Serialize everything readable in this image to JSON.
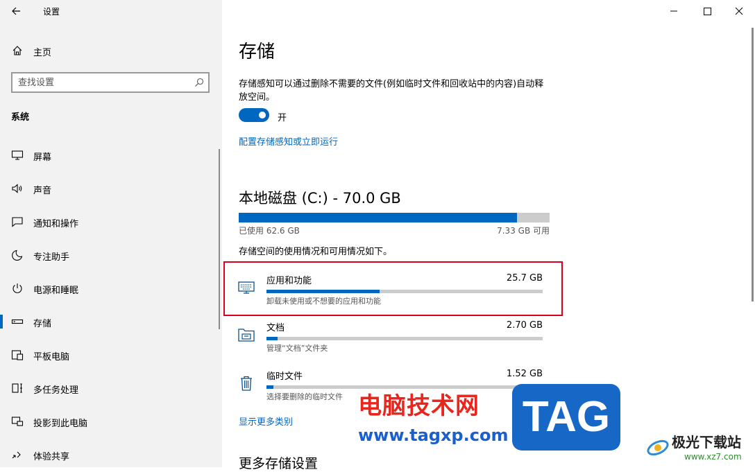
{
  "window": {
    "title": "设置",
    "back_icon": "arrow-left-icon",
    "controls": [
      "minimize-icon",
      "maximize-icon",
      "close-icon"
    ]
  },
  "sidebar": {
    "home_label": "主页",
    "search_placeholder": "查找设置",
    "section_label": "系统",
    "items": [
      {
        "label": "屏幕",
        "icon": "monitor-icon"
      },
      {
        "label": "声音",
        "icon": "speaker-icon"
      },
      {
        "label": "通知和操作",
        "icon": "notification-icon"
      },
      {
        "label": "专注助手",
        "icon": "moon-icon"
      },
      {
        "label": "电源和睡眠",
        "icon": "power-icon"
      },
      {
        "label": "存储",
        "icon": "storage-icon",
        "active": true
      },
      {
        "label": "平板电脑",
        "icon": "tablet-icon"
      },
      {
        "label": "多任务处理",
        "icon": "multitask-icon"
      },
      {
        "label": "投影到此电脑",
        "icon": "project-icon"
      },
      {
        "label": "体验共享",
        "icon": "share-icon"
      }
    ]
  },
  "main": {
    "title": "存储",
    "description": "存储感知可以通过删除不需要的文件(例如临时文件和回收站中的内容)自动释放空间。",
    "toggle_label": "开",
    "toggle_on": true,
    "configure_link": "配置存储感知或立即运行",
    "disk": {
      "title": "本地磁盘 (C:) - 70.0 GB",
      "used_label": "已使用 62.6 GB",
      "free_label": "7.33 GB 可用",
      "used_fraction": 0.894
    },
    "usage_desc": "存储空间的使用情况和可用情况如下。",
    "categories": [
      {
        "name": "应用和功能",
        "size": "25.7 GB",
        "sub": "卸载未使用或不想要的应用和功能",
        "fraction": 0.41,
        "icon": "apps-keyboard-icon"
      },
      {
        "name": "文档",
        "size": "2.70 GB",
        "sub": "管理“文档”文件夹",
        "fraction": 0.04,
        "icon": "documents-folder-icon"
      },
      {
        "name": "临时文件",
        "size": "1.52 GB",
        "sub": "选择要删除的临时文件",
        "fraction": 0.025,
        "icon": "trash-icon"
      }
    ],
    "more_link": "显示更多类别",
    "more_heading": "更多存储设置"
  },
  "watermark": {
    "text1": "电脑技术网",
    "text2": "www.tagxp.com",
    "tag": "TAG",
    "logo_text": "极光下载站",
    "logo_url": "www.xz7.com"
  },
  "colors": {
    "accent": "#0067c0",
    "highlight": "#d9001b",
    "sidebar_bg": "#f2f2f2"
  }
}
